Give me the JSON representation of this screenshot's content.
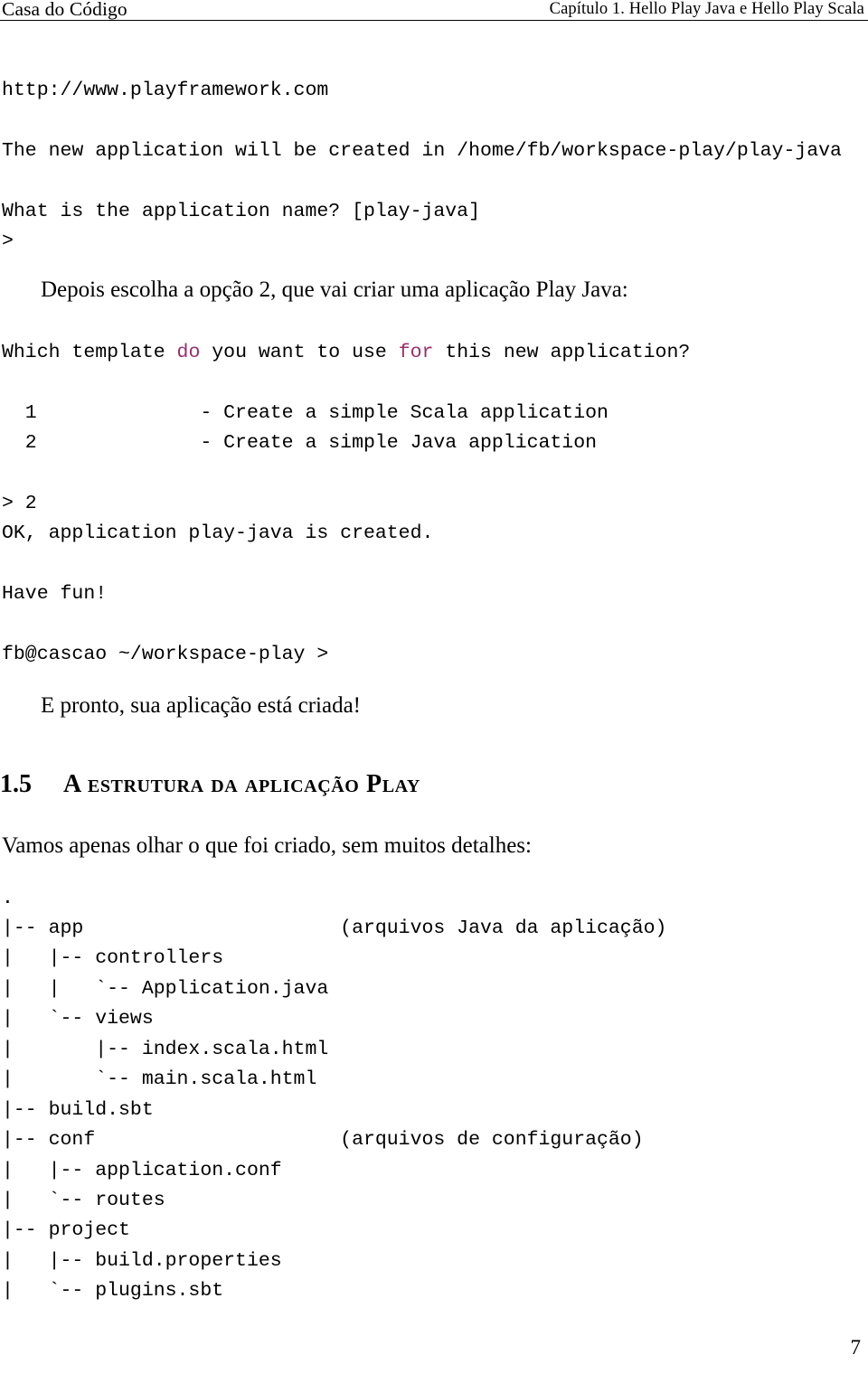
{
  "header": {
    "left": "Casa do Código",
    "right": "Capítulo 1.  Hello Play Java e Hello Play Scala"
  },
  "terminal": {
    "url_line": "http://www.playframework.com",
    "created_in_line": "The new application will be created in /home/fb/workspace-play/play-java",
    "app_name_prompt": "What is the application name? [play-java]",
    "app_name_answer": ">",
    "template_question_pre": "Which template ",
    "template_question_kw1": "do",
    "template_question_mid": " you want to use ",
    "template_question_kw2": "for",
    "template_question_post": " this new application?",
    "option_1": "  1              - Create a simple Scala application",
    "option_2": "  2              - Create a simple Java application",
    "choice_line": "> 2",
    "ok_line": "OK, application play-java is created.",
    "have_fun_line": "Have fun!",
    "prompt_line": "fb@cascao ~/workspace-play >"
  },
  "prose": {
    "escolha_opcao": "Depois escolha a opção 2, que vai criar uma aplicação Play Java:",
    "pronto_criada": "E pronto, sua aplicação está criada!",
    "vamos_olhar": "Vamos apenas olhar o que foi criado, sem muitos detalhes:"
  },
  "section": {
    "number": "1.5",
    "title": "A estrutura da aplicação Play"
  },
  "tree": {
    "lines": [
      ".",
      "|-- app                      (arquivos Java da aplicação)",
      "|   |-- controllers",
      "|   |   `-- Application.java",
      "|   `-- views",
      "|       |-- index.scala.html",
      "|       `-- main.scala.html",
      "|-- build.sbt",
      "|-- conf                     (arquivos de configuração)",
      "|   |-- application.conf",
      "|   `-- routes",
      "|-- project",
      "|   |-- build.properties",
      "|   `-- plugins.sbt"
    ]
  },
  "footer": {
    "page_number": "7"
  },
  "colors": {
    "text": "#000000",
    "keyword": "#9b2d6b",
    "background": "#ffffff"
  }
}
